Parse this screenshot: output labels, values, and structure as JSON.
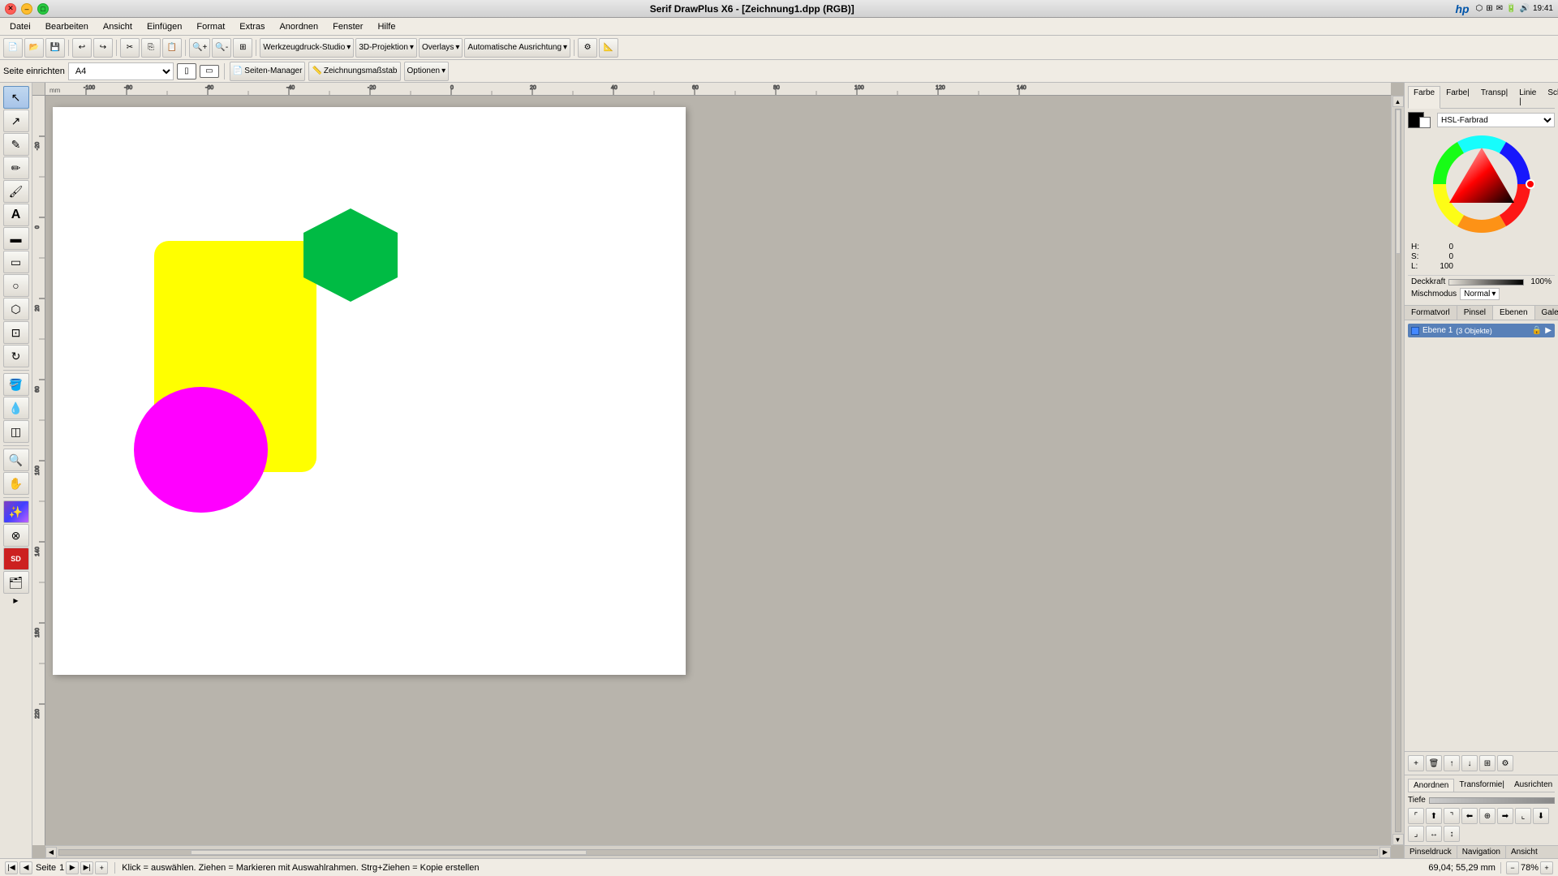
{
  "titlebar": {
    "title": "Serif DrawPlus X6 - [Zeichnung1.dpp (RGB)]",
    "close_btn": "✕",
    "min_btn": "–",
    "max_btn": "□"
  },
  "menubar": {
    "items": [
      "Datei",
      "Bearbeiten",
      "Ansicht",
      "Einfügen",
      "Format",
      "Extras",
      "Anordnen",
      "Fenster",
      "Hilfe"
    ]
  },
  "toolbar": {
    "items": [
      "Werkzeugdruck-Studio",
      "3D-Projektion",
      "Overlays",
      "Automatische Ausrichtung"
    ]
  },
  "toolbar2": {
    "page_setup": "Seite einrichten",
    "page_size": "A4",
    "page_manager": "Seiten-Manager",
    "drawing_scale": "Zeichnungsmaßstab",
    "options": "Optionen"
  },
  "canvas": {
    "shapes": {
      "yellow_rect": {
        "color": "#ffff00",
        "label": "yellow-rounded-rect"
      },
      "green_hex": {
        "color": "#00bb44",
        "label": "green-hexagon"
      },
      "magenta_circle": {
        "color": "#ff00ff",
        "label": "magenta-ellipse"
      }
    }
  },
  "color_panel": {
    "tabs": [
      "Farbe",
      "Farbe|",
      "Transp|",
      "Linie |",
      "Schab"
    ],
    "active_tab": "Farbe",
    "color_model": "HSL-Farbrad",
    "h_value": "0",
    "s_value": "0",
    "l_value": "100",
    "opacity_label": "Deckkraft",
    "opacity_value": "100%",
    "blend_mode_label": "Mischmodus",
    "blend_mode_value": "Normal"
  },
  "format_panel": {
    "tabs": [
      "Formatvorl",
      "Pinsel",
      "Ebenen",
      "Galerie"
    ],
    "active_tab": "Ebenen",
    "layer": {
      "name": "Ebene 1",
      "object_count": "(3 Objekte)"
    }
  },
  "arrange_panel": {
    "tabs": [
      "Anordnen",
      "Transformie|",
      "Ausrichten"
    ],
    "active_tab": "Anordnen",
    "depth_label": "Tiefe"
  },
  "statusbar": {
    "page_label": "Seite",
    "page_num": "1",
    "hint": "Klick = auswählen. Ziehen = Markieren mit Auswahlrahmen. Strg+Ziehen = Kopie erstellen",
    "coordinates": "69,04; 55,29 mm",
    "zoom": "78%",
    "bottom_labels": [
      "Pinseldruck",
      "Navigation",
      "Ansicht"
    ]
  },
  "icons": {
    "arrow": "↖",
    "pen": "✎",
    "text": "A",
    "rect": "▭",
    "ellipse": "○",
    "hex": "⬡",
    "zoom": "🔍",
    "hand": "✋",
    "eyedrop": "💧",
    "fill": "▼",
    "chevron_right": "▶",
    "chevron_left": "◀",
    "chevron_down": "▾",
    "plus": "+",
    "minus": "−",
    "lock": "🔒"
  }
}
